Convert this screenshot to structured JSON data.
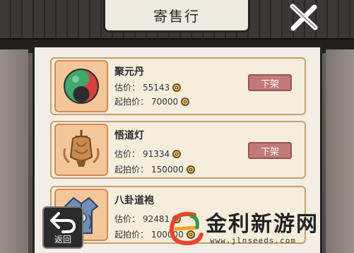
{
  "header": {
    "title": "寄售行"
  },
  "price_labels": {
    "estimate": "估价：",
    "start": "起拍价："
  },
  "items": [
    {
      "name": "聚元丹",
      "estimate": "55143",
      "start_price": "70000",
      "action": "下架",
      "icon": "elixir-pill-icon"
    },
    {
      "name": "悟道灯",
      "estimate": "91334",
      "start_price": "150000",
      "action": "下架",
      "icon": "lantern-icon"
    },
    {
      "name": "八卦道袍",
      "estimate": "92481",
      "start_price": "100000",
      "action": "",
      "icon": "robe-icon"
    }
  ],
  "back_button": {
    "label": "返回"
  },
  "watermark": {
    "text": "金利新游网",
    "url": "www.jlnseeds.com"
  },
  "colors": {
    "unlist_button": "#c27a78",
    "card_border": "#c9a06a",
    "icon_frame": "#f4c79a"
  }
}
